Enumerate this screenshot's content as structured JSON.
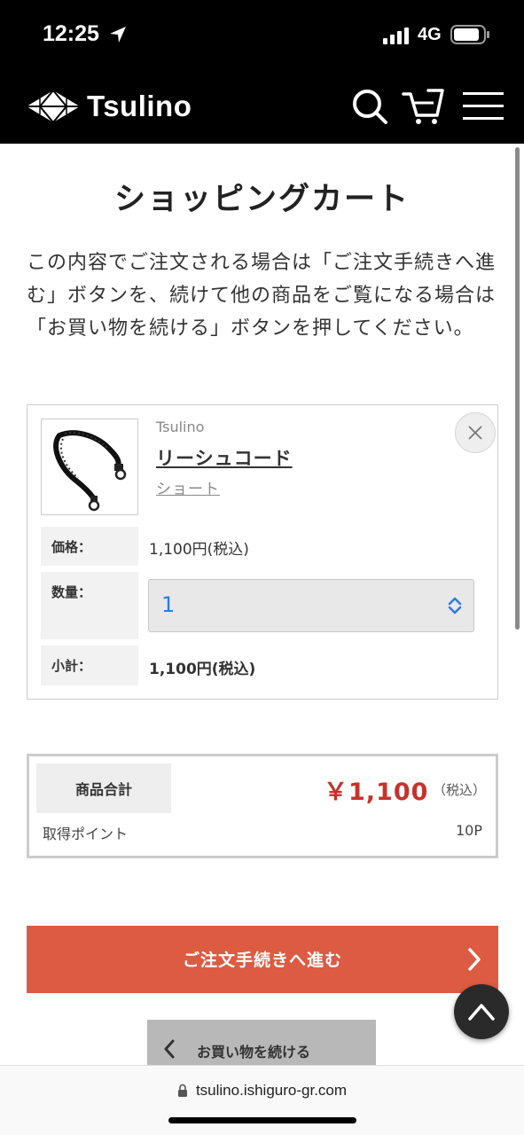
{
  "status_bar": {
    "time": "12:25",
    "network": "4G"
  },
  "header": {
    "logo_text": "Tsulino"
  },
  "page": {
    "title": "ショッピングカート",
    "intro": "この内容でご注文される場合は「ご注文手続きへ進む」ボタンを、続けて他の商品をご覧になる場合は「お買い物を続ける」ボタンを押してください。"
  },
  "cart_item": {
    "brand": "Tsulino",
    "name": "リーシュコード",
    "variant": "ショート",
    "price_label": "価格：",
    "price": "1,100円(税込)",
    "qty_label": "数量：",
    "qty": "1",
    "subtotal_label": "小計：",
    "subtotal": "1,100円(税込)"
  },
  "totals": {
    "label": "商品合計",
    "amount": "￥1,100",
    "tax_note": "（税込）",
    "points_label": "取得ポイント",
    "points": "10P"
  },
  "actions": {
    "checkout": "ご注文手続きへ進む",
    "continue": "お買い物を続ける"
  },
  "browser": {
    "url": "tsulino.ishiguro-gr.com"
  },
  "colors": {
    "accent_red": "#c8322b",
    "checkout_bg": "#dd5b42",
    "header_bg": "#000000",
    "qty_text": "#2f7ae5"
  }
}
